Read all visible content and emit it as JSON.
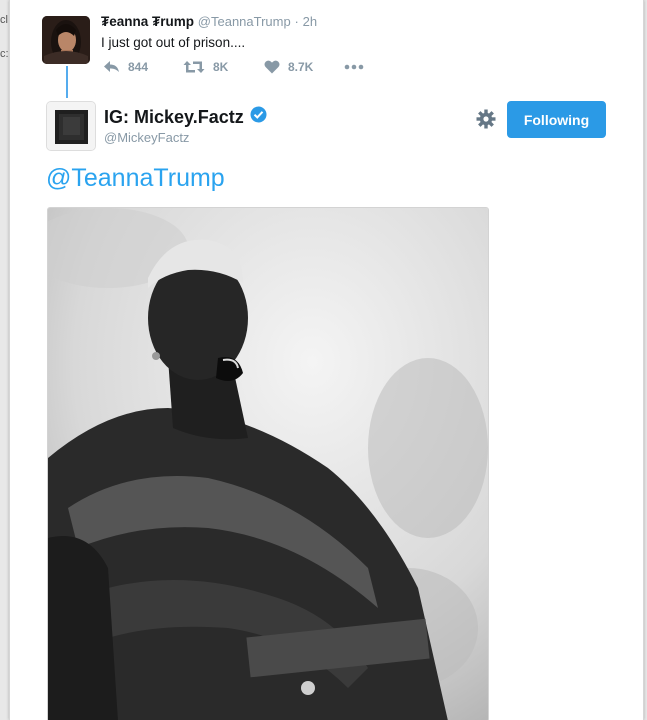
{
  "edge_text": [
    "cl",
    "c:"
  ],
  "parent_tweet": {
    "name": "₮eanna ₮rump",
    "handle": "@TeannaTrump",
    "separator": "·",
    "time": "2h",
    "text": "I just got out of prison....",
    "reply_count": "844",
    "retweet_count": "8K",
    "like_count": "8.7K",
    "more_icon": "ellipsis-icon"
  },
  "main_tweet": {
    "name": "IG: Mickey.Factz",
    "handle": "@MickeyFactz",
    "verified": true,
    "follow_label": "Following",
    "mention_text": "@TeannaTrump",
    "settings_icon": "gear-icon"
  },
  "colors": {
    "accent": "#2b9ae6",
    "link": "#2aa3ef",
    "muted": "#8899a6",
    "thread_line": "#55acee"
  }
}
